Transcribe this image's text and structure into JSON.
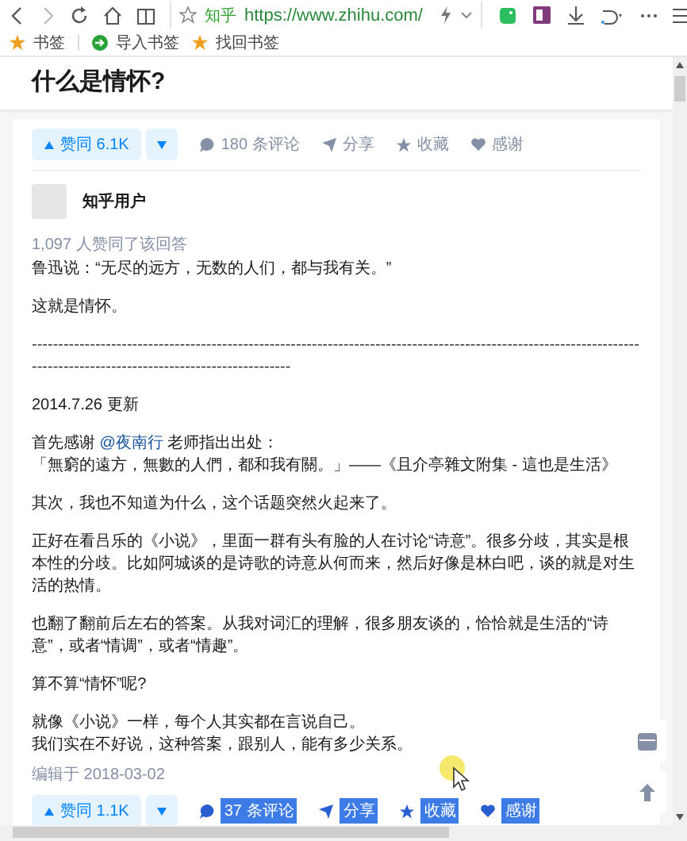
{
  "browser": {
    "site_label": "知乎",
    "url": "https://www.zhihu.com/"
  },
  "bookmarks": [
    {
      "label": "书签",
      "kind": "star"
    },
    {
      "label": "导入书签",
      "kind": "import"
    },
    {
      "label": "找回书签",
      "kind": "star"
    }
  ],
  "question": {
    "title": "什么是情怀?"
  },
  "top_actions": {
    "upvote": "赞同 6.1K",
    "comments": "180 条评论",
    "share": "分享",
    "favorite": "收藏",
    "thanks": "感谢"
  },
  "answer": {
    "author": "知乎用户",
    "votes_note": "1,097 人赞同了该回答",
    "blocks": [
      {
        "kind": "text",
        "lines": [
          "鲁迅说：“无尽的远方，无数的人们，都与我有关。”"
        ]
      },
      {
        "kind": "text",
        "lines": [
          "这就是情怀。"
        ]
      },
      {
        "kind": "rule",
        "text": "--------------------------------------------------------------------------------------------------------------------------------------------------------------------"
      },
      {
        "kind": "text",
        "lines": [
          "2014.7.26 更新"
        ]
      },
      {
        "kind": "credit",
        "lead": "首先感谢 ",
        "link": "@夜南行",
        "tail": " 老师指出出处：",
        "quote": "「無窮的遠方，無數的人們，都和我有關。」——《且介亭雜文附集 - 這也是生活》"
      },
      {
        "kind": "text",
        "lines": [
          "其次，我也不知道为什么，这个话题突然火起来了。"
        ]
      },
      {
        "kind": "text",
        "lines": [
          "正好在看吕乐的《小说》，里面一群有头有脸的人在讨论“诗意”。很多分歧，其实是根本性的分歧。比如阿城谈的是诗歌的诗意从何而来，然后好像是林白吧，谈的就是对生活的热情。"
        ]
      },
      {
        "kind": "text",
        "lines": [
          "也翻了翻前后左右的答案。从我对词汇的理解，很多朋友谈的，恰恰就是生活的“诗意”，或者“情调”，或者“情趣”。"
        ]
      },
      {
        "kind": "text",
        "lines": [
          "算不算“情怀”呢?"
        ]
      },
      {
        "kind": "text",
        "lines": [
          "就像《小说》一样，每个人其实都在言说自己。",
          "我们实在不好说，这种答案，跟别人，能有多少关系。"
        ]
      }
    ],
    "edited": "编辑于 2018-03-02",
    "bottom_actions": {
      "upvote": "赞同 1.1K",
      "items": [
        {
          "kind": "comment",
          "label": "37 条评论",
          "selected": true
        },
        {
          "kind": "share",
          "label": "分享",
          "selected": true
        },
        {
          "kind": "favorite",
          "label": "收藏",
          "selected": true
        },
        {
          "kind": "thanks",
          "label": "感谢",
          "selected": true
        }
      ]
    }
  }
}
